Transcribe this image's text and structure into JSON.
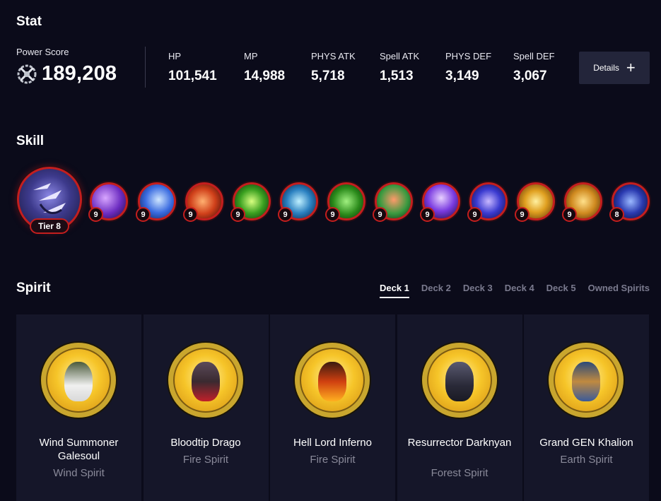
{
  "stat": {
    "title": "Stat",
    "power_score_label": "Power Score",
    "power_score": "189,208",
    "stats": [
      {
        "label": "HP",
        "value": "101,541"
      },
      {
        "label": "MP",
        "value": "14,988"
      },
      {
        "label": "PHYS ATK",
        "value": "5,718"
      },
      {
        "label": "Spell ATK",
        "value": "1,513"
      },
      {
        "label": "PHYS DEF",
        "value": "3,149"
      },
      {
        "label": "Spell DEF",
        "value": "3,067"
      }
    ],
    "details_label": "Details",
    "details_icon": "plus-icon"
  },
  "skill": {
    "title": "Skill",
    "main_tier": "Tier 8",
    "levels": [
      "9",
      "9",
      "9",
      "9",
      "9",
      "9",
      "9",
      "9",
      "9",
      "9",
      "9",
      "8"
    ]
  },
  "spirit": {
    "title": "Spirit",
    "tabs": [
      "Deck 1",
      "Deck 2",
      "Deck 3",
      "Deck 4",
      "Deck 5",
      "Owned Spirits"
    ],
    "active_tab": "Deck 1",
    "cards": [
      {
        "name": "Wind Summoner Galesoul",
        "type": "Wind Spirit"
      },
      {
        "name": "Bloodtip Drago",
        "type": "Fire Spirit"
      },
      {
        "name": "Hell Lord Inferno",
        "type": "Fire Spirit"
      },
      {
        "name": "Resurrector Darknyan",
        "type": "Forest Spirit"
      },
      {
        "name": "Grand GEN Khalion",
        "type": "Earth Spirit"
      }
    ]
  },
  "colors": {
    "background": "#0b0b1a",
    "card_bg": "#151629",
    "skill_ring": "#c41e1e",
    "portrait_gold": "#f6c529"
  }
}
